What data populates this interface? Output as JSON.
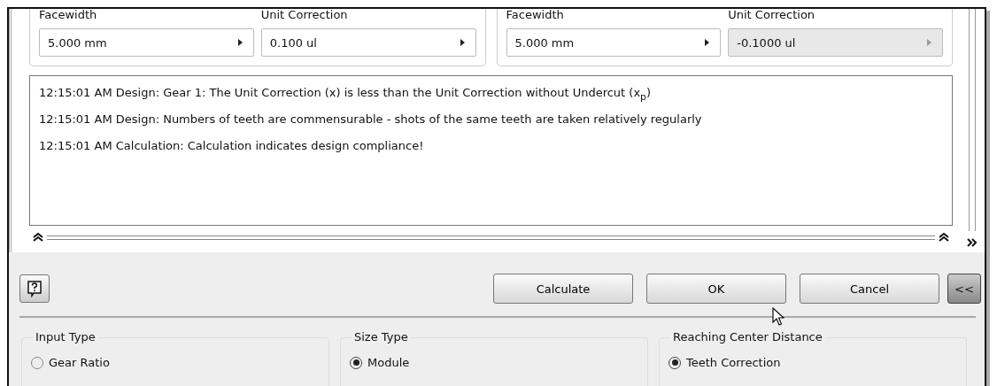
{
  "gear_panels": [
    {
      "fields": [
        {
          "label": "Facewidth",
          "value": "5.000 mm",
          "disabled": false
        },
        {
          "label": "Unit Correction",
          "value": "0.100 ul",
          "disabled": false
        }
      ]
    },
    {
      "fields": [
        {
          "label": "Facewidth",
          "value": "5.000 mm",
          "disabled": false
        },
        {
          "label": "Unit Correction",
          "value": "-0.1000 ul",
          "disabled": true
        }
      ]
    }
  ],
  "log": [
    "12:15:01 AM Design: Gear 1: The Unit Correction (x) is less than the Unit Correction without Undercut (x$_{p}$)",
    "12:15:01 AM Design: Numbers of teeth are commensurable - shots of the same teeth are taken relatively regularly",
    "12:15:01 AM Calculation: Calculation indicates design compliance!"
  ],
  "buttons": [
    {
      "label": "Calculate"
    },
    {
      "label": "OK"
    },
    {
      "label": "Cancel"
    }
  ],
  "collapse_button": "<<",
  "groups": [
    {
      "title": "Input Type",
      "options": [
        {
          "label": "Gear Ratio",
          "selected": false
        }
      ]
    },
    {
      "title": "Size Type",
      "options": [
        {
          "label": "Module",
          "selected": true
        }
      ]
    },
    {
      "title": "Reaching Center Distance",
      "options": [
        {
          "label": "Teeth Correction",
          "selected": true
        }
      ]
    }
  ]
}
